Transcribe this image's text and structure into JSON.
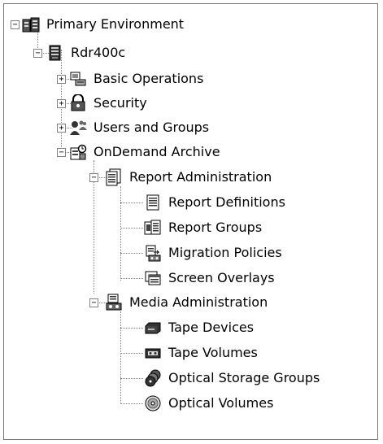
{
  "tree": {
    "root": {
      "label": "Primary Environment",
      "icon": "environment-icon",
      "expanded": true
    },
    "server": {
      "label": "Rdr400c",
      "icon": "server-icon",
      "expanded": true
    },
    "basic_ops": {
      "label": "Basic Operations",
      "icon": "basic-operations-icon",
      "expanded": false
    },
    "security": {
      "label": "Security",
      "icon": "security-icon",
      "expanded": false
    },
    "users_groups": {
      "label": "Users and Groups",
      "icon": "users-groups-icon",
      "expanded": false
    },
    "ondemand": {
      "label": "OnDemand Archive",
      "icon": "archive-icon",
      "expanded": true
    },
    "report_admin": {
      "label": "Report Administration",
      "icon": "report-admin-icon",
      "expanded": true
    },
    "report_defs": {
      "label": "Report Definitions",
      "icon": "report-definitions-icon"
    },
    "report_groups": {
      "label": "Report Groups",
      "icon": "report-groups-icon"
    },
    "migration": {
      "label": "Migration Policies",
      "icon": "migration-policies-icon"
    },
    "screen_overlays": {
      "label": "Screen Overlays",
      "icon": "screen-overlays-icon"
    },
    "media_admin": {
      "label": "Media Administration",
      "icon": "media-admin-icon",
      "expanded": true
    },
    "tape_devices": {
      "label": "Tape Devices",
      "icon": "tape-device-icon"
    },
    "tape_volumes": {
      "label": "Tape Volumes",
      "icon": "tape-volume-icon"
    },
    "optical_groups": {
      "label": "Optical Storage Groups",
      "icon": "optical-storage-groups-icon"
    },
    "optical_volumes": {
      "label": "Optical Volumes",
      "icon": "optical-volume-icon"
    }
  },
  "expander_symbols": {
    "expanded": "−",
    "collapsed": "+"
  }
}
